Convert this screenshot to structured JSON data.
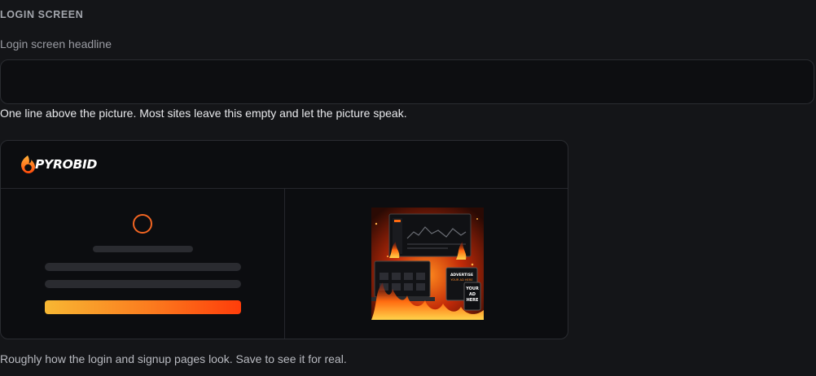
{
  "section": {
    "title": "LOGIN SCREEN"
  },
  "headline_field": {
    "label": "Login screen headline",
    "value": "",
    "placeholder": "",
    "help": "One line above the picture. Most sites leave this empty and let the picture speak."
  },
  "preview": {
    "brand": {
      "name": "PYROBID",
      "icon": "flame-logo-icon"
    },
    "spinner_icon": "loading-ring-icon",
    "accent_gradient": [
      "#f7b733",
      "#fb7a1e",
      "#ff3d0a"
    ],
    "promo_image": {
      "icon": "promo-flame-image",
      "texts": [
        "ADVERTISE YOUR AD HERE",
        "YOUR",
        "AD",
        "HERE"
      ]
    },
    "help": "Roughly how the login and signup pages look. Save to see it for real."
  },
  "colors": {
    "background": "#141518",
    "panel": "#0c0d10",
    "border": "#2a2c31",
    "accent": "#f26522"
  }
}
